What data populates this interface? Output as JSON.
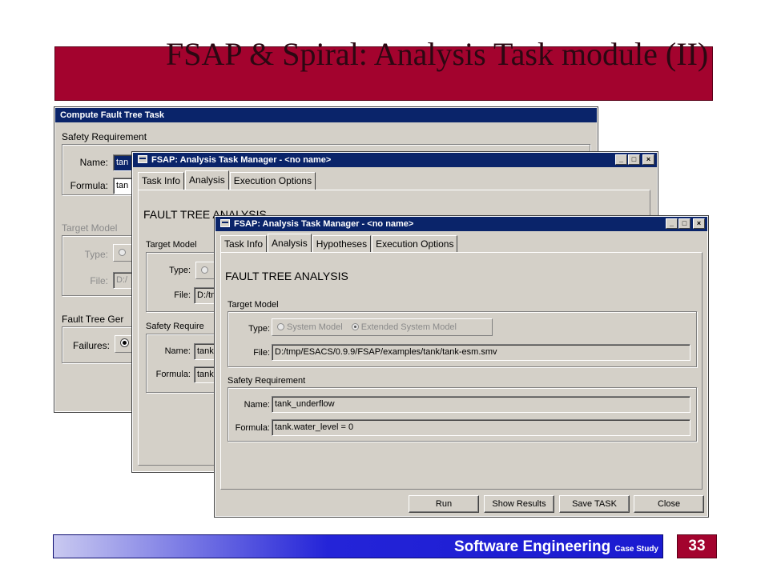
{
  "slide": {
    "title": "FSAP & Spiral: Analysis Task module (II)",
    "footer": {
      "main": "Software Engineering",
      "sub": "Case Study",
      "page": "33"
    }
  },
  "win1": {
    "title": "Compute Fault Tree Task",
    "safety_req_label": "Safety Requirement",
    "name_label": "Name:",
    "name_value": "tan",
    "formula_label": "Formula:",
    "formula_value": "tan",
    "target_model_label": "Target Model",
    "type_label": "Type:",
    "file_label": "File:",
    "file_value": "D:/",
    "fault_tree_label": "Fault Tree Ger",
    "failures_label": "Failures:"
  },
  "win2": {
    "title": "FSAP: Analysis Task Manager - <no name>",
    "tabs": [
      "Task Info",
      "Analysis",
      "Execution Options"
    ],
    "heading": "FAULT TREE ANALYSIS",
    "target_model_label": "Target Model",
    "type_label": "Type:",
    "file_label": "File:",
    "file_value": "D:/tm",
    "safety_req_label": "Safety Require",
    "name_label": "Name:",
    "name_value": "tank",
    "formula_label": "Formula:",
    "formula_value": "tank"
  },
  "win3": {
    "title": "FSAP: Analysis Task Manager - <no name>",
    "tabs": [
      "Task Info",
      "Analysis",
      "Hypotheses",
      "Execution Options"
    ],
    "heading": "FAULT TREE ANALYSIS",
    "target_model_label": "Target Model",
    "type_label": "Type:",
    "radio_system": "System Model",
    "radio_extended": "Extended System Model",
    "file_label": "File:",
    "file_value": "D:/tmp/ESACS/0.9.9/FSAP/examples/tank/tank-esm.smv",
    "safety_req_label": "Safety Requirement",
    "name_label": "Name:",
    "name_value": "tank_underflow",
    "formula_label": "Formula:",
    "formula_value": "tank.water_level = 0",
    "buttons": [
      "Run",
      "Show Results",
      "Save TASK",
      "Close"
    ]
  },
  "caption_buttons": {
    "min": "_",
    "max": "□",
    "close": "×"
  },
  "colors": {
    "slide_accent": "#a3032e",
    "title_bar": "#0a246a",
    "window_face": "#d4d0c8",
    "footer_blue": "#1a1ad0"
  }
}
